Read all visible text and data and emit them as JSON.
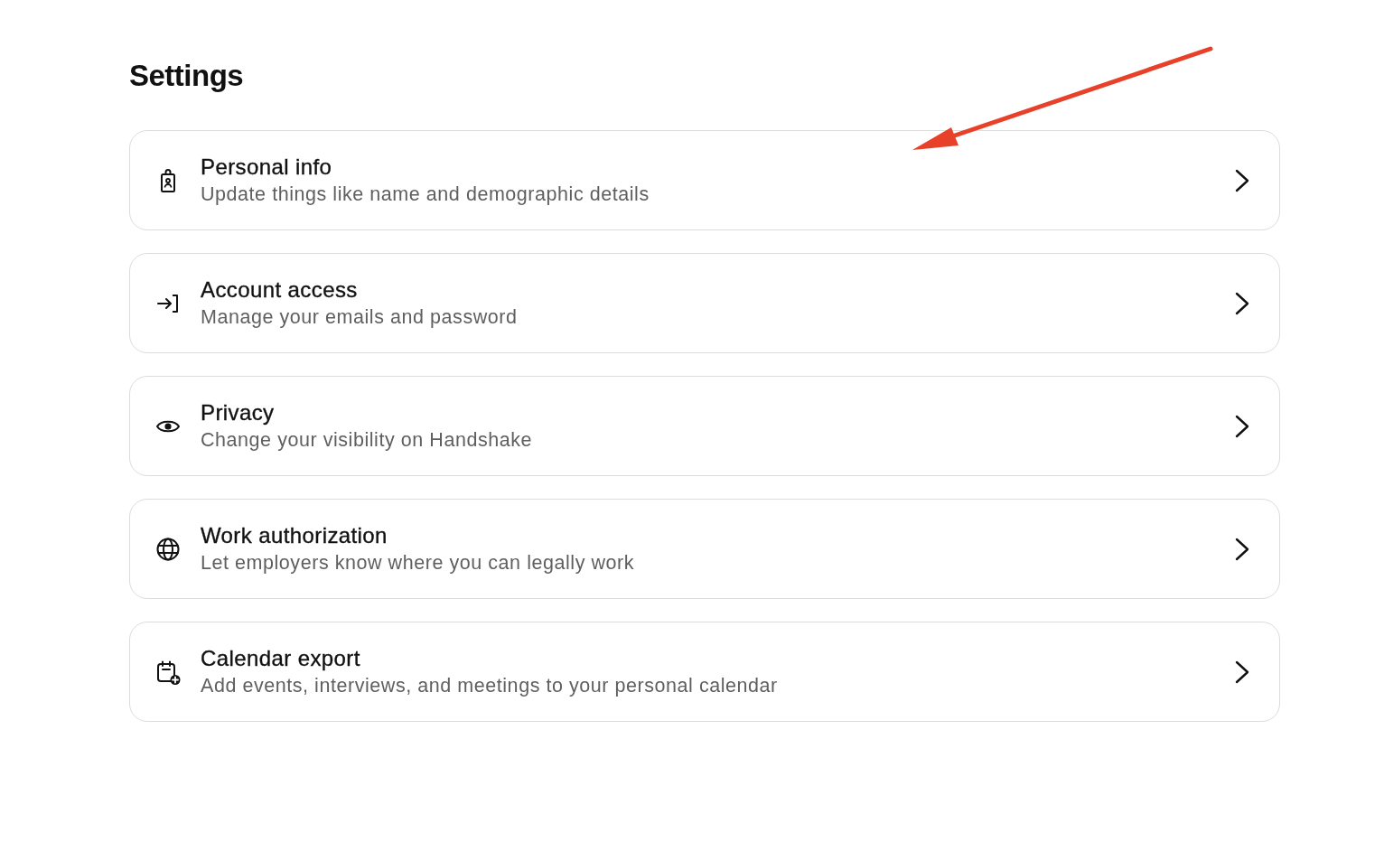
{
  "page": {
    "title": "Settings"
  },
  "items": [
    {
      "title": "Personal info",
      "description": "Update things like name and demographic details"
    },
    {
      "title": "Account access",
      "description": "Manage your emails and password"
    },
    {
      "title": "Privacy",
      "description": "Change your visibility on Handshake"
    },
    {
      "title": "Work authorization",
      "description": "Let employers know where you can legally work"
    },
    {
      "title": "Calendar export",
      "description": "Add events, interviews, and meetings to your personal calendar"
    }
  ]
}
